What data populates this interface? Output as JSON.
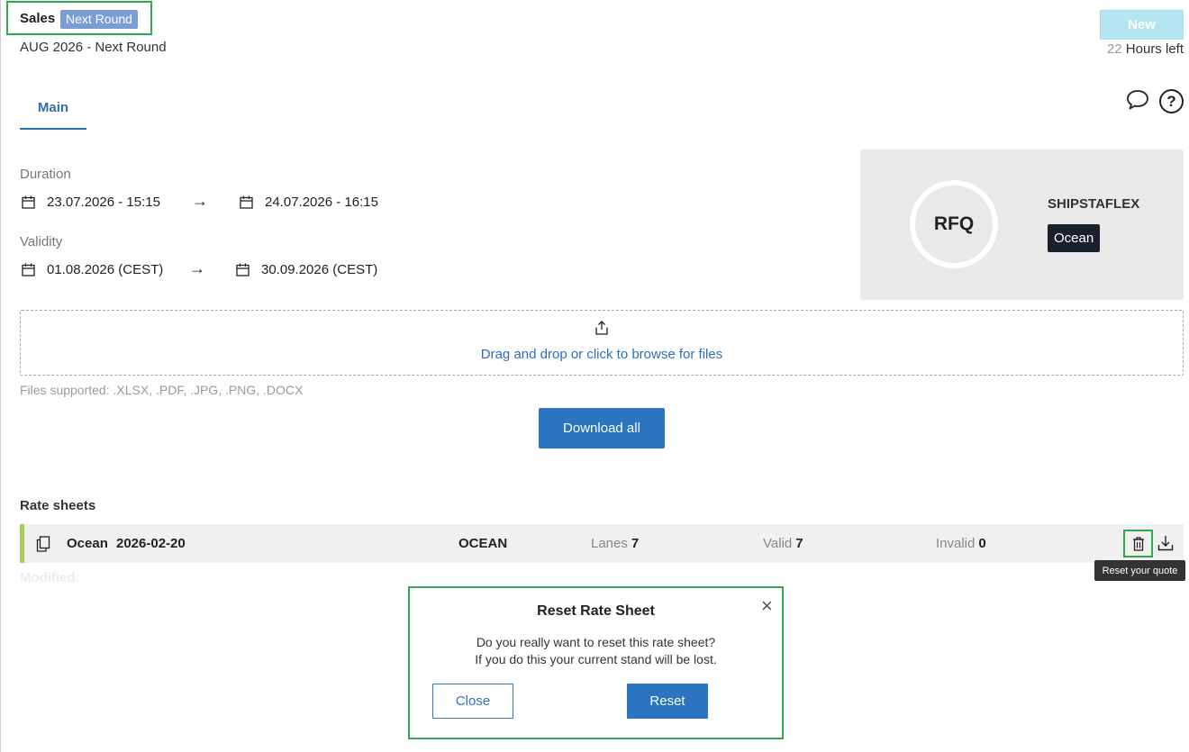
{
  "header": {
    "title": "Sales",
    "round_badge": "Next Round",
    "subtitle": "AUG 2026 - Next Round",
    "status_button": "New",
    "hours_value": "22",
    "hours_label": "Hours left"
  },
  "tabs": [
    {
      "label": "Main",
      "active": true
    }
  ],
  "icons": {
    "chat": "chat-bubble-icon",
    "help": "help-icon",
    "help_glyph": "?"
  },
  "duration": {
    "label": "Duration",
    "start": "23.07.2026 - 15:15",
    "end": "24.07.2026 - 16:15"
  },
  "validity": {
    "label": "Validity",
    "start": "01.08.2026 (CEST)",
    "end": "30.09.2026 (CEST)"
  },
  "rfq_card": {
    "type": "RFQ",
    "company": "SHIPSTAFLEX",
    "mode": "Ocean"
  },
  "dropzone": {
    "text": "Drag and drop or click to browse for files",
    "files_supported": "Files supported: .XLSX, .PDF, .JPG, .PNG, .DOCX"
  },
  "download_all": "Download all",
  "rate_sheets": {
    "title": "Rate sheets",
    "rows": [
      {
        "name": "Ocean",
        "date": "2026-02-20",
        "mode": "OCEAN",
        "lanes_label": "Lanes",
        "lanes": "7",
        "valid_label": "Valid",
        "valid": "7",
        "invalid_label": "Invalid",
        "invalid": "0"
      }
    ],
    "tooltip": "Reset your quote",
    "modified_label": "Modified:"
  },
  "dialog": {
    "title": "Reset Rate Sheet",
    "line1": "Do you really want to reset this rate sheet?",
    "line2": "If you do this your current stand will be lost.",
    "close_label": "Close",
    "reset_label": "Reset",
    "close_glyph": "×"
  },
  "colors": {
    "primary": "#2a74c0",
    "highlight": "#2fa84f",
    "badge": "#7a9ed3",
    "new_button": "#b3e6f0",
    "row_accent": "#a6ce5a"
  }
}
